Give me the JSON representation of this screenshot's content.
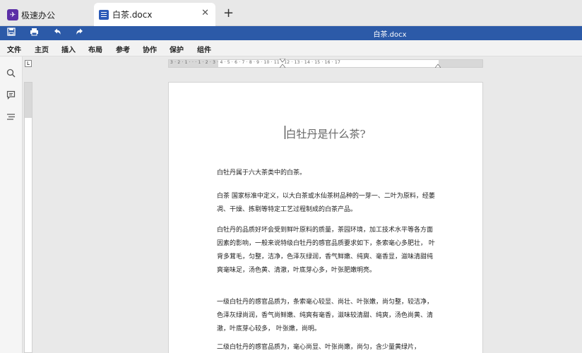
{
  "tabs": {
    "home_label": "极速办公",
    "doc_label": "白茶.docx",
    "close_glyph": "✕",
    "add_glyph": "+"
  },
  "window": {
    "title": "白茶.docx"
  },
  "menu": [
    "文件",
    "主页",
    "插入",
    "布局",
    "参考",
    "协作",
    "保护",
    "组件"
  ],
  "ruler": {
    "h_numbers": "3 · 2 · 1 ·  ·  · 1 · 2 · 3 · 4 · 5 · 6 · 7 · 8 · 9 · 10 · 11 · 12 · 13 · 14 · 15 · 16 · 17",
    "corner": "L"
  },
  "document": {
    "title": "白牡丹是什么茶?",
    "paragraphs": [
      "白牡丹属于六大茶类中的白茶。",
      "  白茶  国家标准中定义，以大白茶或水仙茶树品种的一芽一、二叶为原料，经萎凋、干燥、拣剔等特定工艺过程制成的白茶产品。",
      "白牡丹的品质好坏会受到鲜叶原料的质量，茶园环境，加工技术水平等各方面因素的影响，一般来说特级白牡丹的感官品质要求如下，条索毫心多肥壮，  叶背多茸毛，匀整，洁净，色泽灰绿润，香气鲜嫩、纯爽、毫香显，滋味清甜纯爽毫味足，汤色黄、清澈，叶底芽心多，叶张肥嫩明亮。",
      "一级白牡丹的感官品质为，条索毫心较显、尚壮、叶张嫩，尚匀整，较洁净，色泽灰绿尚润，香气尚鲜嫩、纯爽有毫香，滋味较清甜、纯爽，汤色尚黄、清澈，叶底芽心较多，  叶张嫩，尚明。",
      "二级白牡丹的感官品质为，毫心尚显、叶张尚嫩，尚匀，含少量黄绿片，"
    ]
  }
}
